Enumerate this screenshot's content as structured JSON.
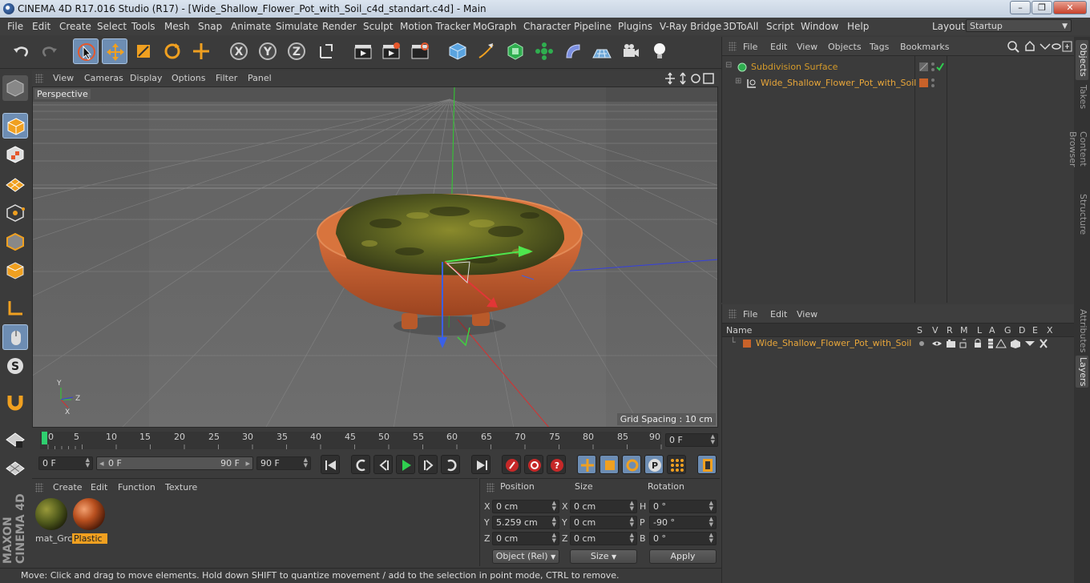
{
  "window": {
    "title": "CINEMA 4D R17.016 Studio (R17) - [Wide_Shallow_Flower_Pot_with_Soil_c4d_standart.c4d] - Main",
    "buttons": [
      "–",
      "❐",
      "✕"
    ]
  },
  "menu": [
    "File",
    "Edit",
    "Create",
    "Select",
    "Tools",
    "Mesh",
    "Snap",
    "Animate",
    "Simulate",
    "Render",
    "Sculpt",
    "Motion Tracker",
    "MoGraph",
    "Character",
    "Pipeline",
    "Plugins",
    "V-Ray Bridge",
    "3DToAll",
    "Script",
    "Window",
    "Help"
  ],
  "layout": {
    "label": "Layout:",
    "value": "Startup"
  },
  "viewport": {
    "menu": [
      "View",
      "Cameras",
      "Display",
      "Options",
      "Filter",
      "Panel"
    ],
    "label": "Perspective",
    "grid_spacing": "Grid Spacing : 10 cm",
    "axis": {
      "x": "X",
      "y": "Y",
      "z": "Z"
    }
  },
  "timeline": {
    "ticks": [
      "0",
      "5",
      "10",
      "15",
      "20",
      "25",
      "30",
      "35",
      "40",
      "45",
      "50",
      "55",
      "60",
      "65",
      "70",
      "75",
      "80",
      "85",
      "90"
    ],
    "current_frame": "0 F",
    "start_field": "0 F",
    "range_start": "0 F",
    "range_end": "90 F",
    "end_field": "90 F"
  },
  "materials": {
    "menu": [
      "Create",
      "Edit",
      "Function",
      "Texture"
    ],
    "items": [
      {
        "name": "mat_Grc",
        "selected": false
      },
      {
        "name": "Plastic",
        "selected": true
      }
    ]
  },
  "coords": {
    "headers": [
      "Position",
      "Size",
      "Rotation"
    ],
    "rows": [
      {
        "axis": "X",
        "pos": "0 cm",
        "size_axis": "X",
        "size": "0 cm",
        "rot_axis": "H",
        "rot": "0 °"
      },
      {
        "axis": "Y",
        "pos": "5.259 cm",
        "size_axis": "Y",
        "size": "0 cm",
        "rot_axis": "P",
        "rot": "-90 °"
      },
      {
        "axis": "Z",
        "pos": "0 cm",
        "size_axis": "Z",
        "size": "0 cm",
        "rot_axis": "B",
        "rot": "0 °"
      }
    ],
    "mode": "Object (Rel)",
    "size_mode": "Size",
    "apply": "Apply"
  },
  "status": "Move: Click and drag to move elements. Hold down SHIFT to quantize movement / add to the selection in point mode, CTRL to remove.",
  "objects": {
    "menu": [
      "File",
      "Edit",
      "View",
      "Objects",
      "Tags",
      "Bookmarks"
    ],
    "items": [
      {
        "name": "Subdivision Surface",
        "color": "#d49a2a"
      },
      {
        "name": "Wide_Shallow_Flower_Pot_with_Soil",
        "color": "#e8a63a"
      }
    ]
  },
  "layers": {
    "menu": [
      "File",
      "Edit",
      "View"
    ],
    "header_name": "Name",
    "columns": [
      "S",
      "V",
      "R",
      "M",
      "L",
      "A",
      "G",
      "D",
      "E",
      "X"
    ],
    "items": [
      {
        "name": "Wide_Shallow_Flower_Pot_with_Soil",
        "color": "#c8622a"
      }
    ]
  },
  "side_tabs": [
    "Objects",
    "Takes",
    "Content Browser",
    "Structure",
    "Attributes",
    "Layers"
  ],
  "brand": "MAXON CINEMA 4D"
}
